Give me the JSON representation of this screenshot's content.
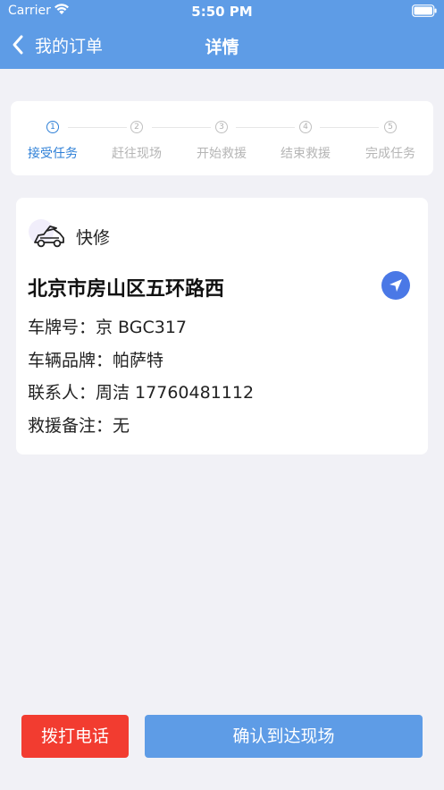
{
  "status_bar": {
    "carrier": "Carrier",
    "time": "5:50 PM"
  },
  "nav": {
    "back_label": "我的订单",
    "title": "详情"
  },
  "steps": [
    {
      "number": "1",
      "label": "接受任务",
      "active": true
    },
    {
      "number": "2",
      "label": "赶往现场",
      "active": false
    },
    {
      "number": "3",
      "label": "开始救援",
      "active": false
    },
    {
      "number": "4",
      "label": "结束救援",
      "active": false
    },
    {
      "number": "5",
      "label": "完成任务",
      "active": false
    }
  ],
  "order": {
    "service_type": "快修",
    "service_icon": "car-repair-icon",
    "address": "北京市房山区五环路西",
    "fields": [
      {
        "label": "车牌号：",
        "value": "京 BGC317"
      },
      {
        "label": "车辆品牌：",
        "value": "帕萨特"
      },
      {
        "label": "联系人：",
        "value": "周洁 17760481112"
      },
      {
        "label": "救援备注：",
        "value": "无"
      }
    ]
  },
  "actions": {
    "call_label": "拨打电话",
    "confirm_label": "确认到达现场"
  },
  "colors": {
    "header": "#5e9ce6",
    "active_step": "#2f80d7",
    "call_button": "#f23c30",
    "confirm_button": "#5e9ce6",
    "navigate_button": "#4a78e6"
  }
}
